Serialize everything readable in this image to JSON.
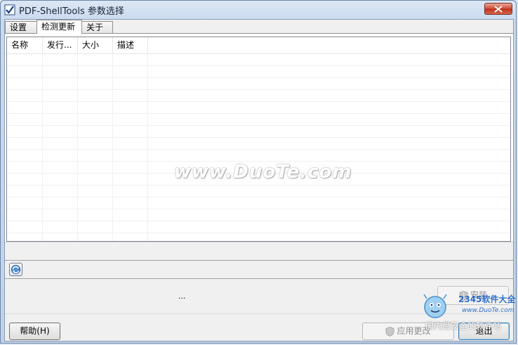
{
  "window": {
    "title": "PDF-ShellTools 参数选择"
  },
  "tabs": [
    {
      "label": "设置"
    },
    {
      "label": "检测更新"
    },
    {
      "label": "关于"
    }
  ],
  "updates_list": {
    "columns": [
      "名称",
      "发行...",
      "大小",
      "描述"
    ],
    "rows": []
  },
  "status": {
    "text": "..."
  },
  "buttons": {
    "install": "安装",
    "help": "帮助(H)",
    "apply": "应用更改",
    "exit": "退出"
  },
  "watermark": {
    "site": "www.DuoTe.com",
    "logo_line1": "2345软件大全",
    "logo_line2": "www.DuoTe.com",
    "logo_line3": "国内最安全的软件站"
  },
  "colors": {
    "accent": "#3c7fb1",
    "close": "#c0301b"
  }
}
